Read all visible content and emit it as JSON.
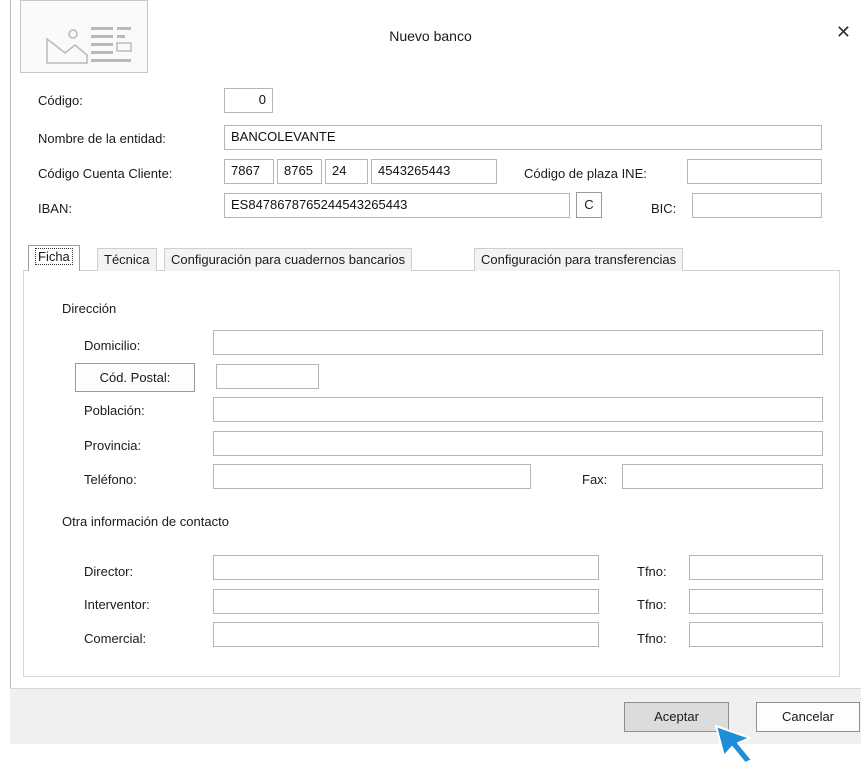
{
  "window": {
    "title": "Nuevo banco",
    "close_glyph": "✕"
  },
  "header": {
    "codigo_label": "Código:",
    "codigo_value": "0",
    "nombre_label": "Nombre de la entidad:",
    "nombre_value": "BANCOLEVANTE",
    "ccc_label": "Código Cuenta Cliente:",
    "ccc_entidad": "7867",
    "ccc_oficina": "8765",
    "ccc_dc": "24",
    "ccc_cuenta": "4543265443",
    "plaza_label": "Código de plaza INE:",
    "plaza_value": "",
    "iban_label": "IBAN:",
    "iban_value": "ES8478678765244543265443",
    "iban_button": "C",
    "bic_label": "BIC:",
    "bic_value": ""
  },
  "tabs": [
    {
      "label": "Ficha",
      "active": true
    },
    {
      "label": "Técnica"
    },
    {
      "label": "Configuración para cuadernos bancarios"
    },
    {
      "label": "Configuración para transferencias"
    }
  ],
  "direccion": {
    "heading": "Dirección",
    "domicilio_label": "Domicilio:",
    "domicilio_value": "",
    "postal_button": "Cód. Postal:",
    "postal_value": "",
    "poblacion_label": "Población:",
    "poblacion_value": "",
    "provincia_label": "Provincia:",
    "provincia_value": "",
    "telefono_label": "Teléfono:",
    "telefono_value": "",
    "fax_label": "Fax:",
    "fax_value": ""
  },
  "contacto": {
    "heading": "Otra información de contacto",
    "director_label": "Director:",
    "interventor_label": "Interventor:",
    "comercial_label": "Comercial:",
    "tfno_label": "Tfno:"
  },
  "footer": {
    "accept": "Aceptar",
    "cancel": "Cancelar"
  },
  "colors": {
    "accept_bg": "#dcdcdc",
    "cursor": "#1f8ed8"
  }
}
